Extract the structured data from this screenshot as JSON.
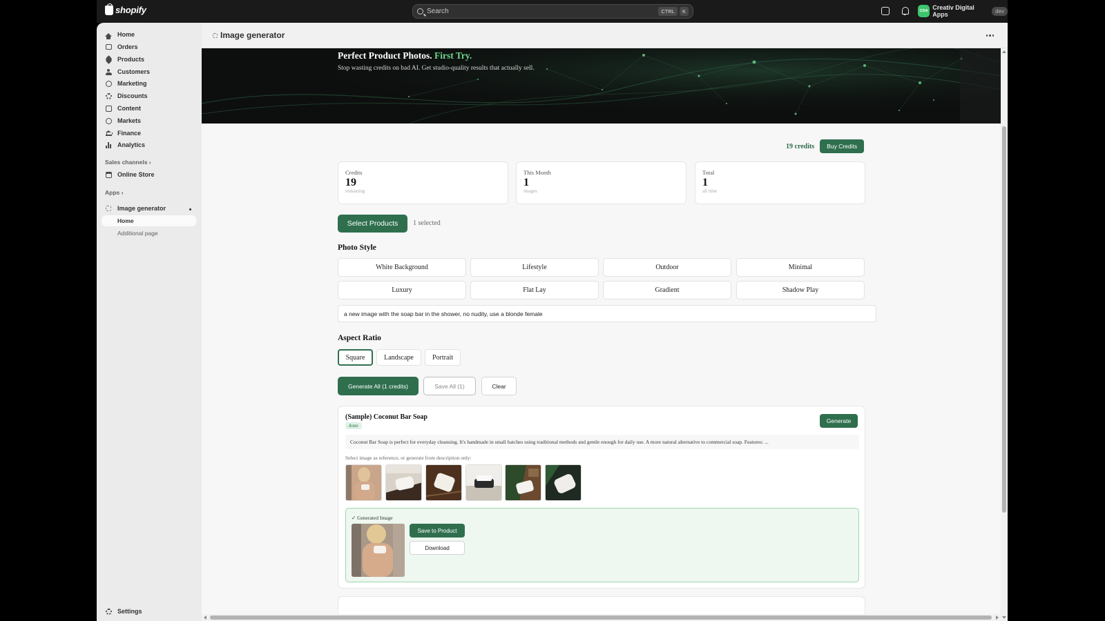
{
  "topbar": {
    "brand": "shopify",
    "search_placeholder": "Search",
    "shortcut_keys": [
      "CTRL",
      "K"
    ],
    "account_initials": "CDA",
    "account_name": "Creativ Digital Apps",
    "account_badge": "dev"
  },
  "sidebar": {
    "items": [
      {
        "label": "Home",
        "icon": "home-icon"
      },
      {
        "label": "Orders",
        "icon": "orders-icon"
      },
      {
        "label": "Products",
        "icon": "tag-icon"
      },
      {
        "label": "Customers",
        "icon": "person-icon"
      },
      {
        "label": "Marketing",
        "icon": "target-icon"
      },
      {
        "label": "Discounts",
        "icon": "discount-icon"
      },
      {
        "label": "Content",
        "icon": "content-icon"
      },
      {
        "label": "Markets",
        "icon": "globe-icon"
      },
      {
        "label": "Finance",
        "icon": "bank-icon"
      },
      {
        "label": "Analytics",
        "icon": "bar-chart-icon"
      }
    ],
    "sales_channels_label": "Sales channels",
    "online_store_label": "Online Store",
    "apps_label": "Apps",
    "app_name": "Image generator",
    "app_sub_items": [
      "Home",
      "Additional page"
    ],
    "settings_label": "Settings"
  },
  "page": {
    "title": "Image generator"
  },
  "hero": {
    "title": "Perfect Product Photos.",
    "title_accent": "First Try.",
    "subtitle": "Stop wasting credits on bad AI. Get studio-quality results that actually sell."
  },
  "credits": {
    "count_label": "19 credits",
    "buy_label": "Buy Credits"
  },
  "stats": [
    {
      "label": "Credits",
      "value": "19",
      "sub": "remaining"
    },
    {
      "label": "This Month",
      "value": "1",
      "sub": "images"
    },
    {
      "label": "Total",
      "value": "1",
      "sub": "all time"
    }
  ],
  "selection": {
    "button_label": "Select Products",
    "selected_text": "1 selected"
  },
  "photo_style": {
    "heading": "Photo Style",
    "options": [
      "White Background",
      "Lifestyle",
      "Outdoor",
      "Minimal",
      "Luxury",
      "Flat Lay",
      "Gradient",
      "Shadow Play"
    ]
  },
  "prompt": {
    "value": "a new image with the soap bar in the shower, no nudity, use a blonde female"
  },
  "aspect_ratio": {
    "heading": "Aspect Ratio",
    "options": [
      "Square",
      "Landscape",
      "Portrait"
    ],
    "selected": "Square"
  },
  "actions": {
    "generate_all": "Generate All (1 credits)",
    "save_all": "Save All (1)",
    "clear": "Clear"
  },
  "product_card": {
    "title": "(Sample) Coconut Bar Soap",
    "status": "done",
    "generate_label": "Generate",
    "description": "Coconut Bar Soap is perfect for everyday cleansing. It's handmade in small batches using traditional methods and gentle enough for daily use. A more natural alternative to commercial soap. Features: ...",
    "reference_label": "Select image as reference, or generate from description only:",
    "generated_label": "✓ Generated Image",
    "save_label": "Save to Product",
    "download_label": "Download"
  },
  "colors": {
    "accent": "#2f6f4e",
    "hero_accent": "#6fd58f",
    "topbar": "#1a1a1a"
  }
}
